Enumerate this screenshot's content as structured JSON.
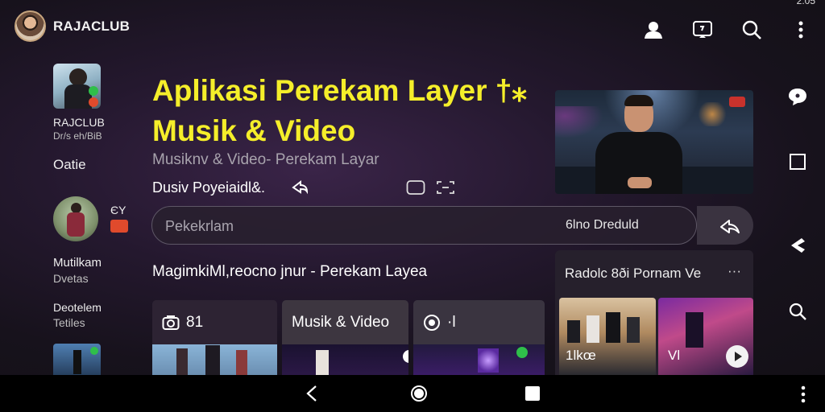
{
  "status": {
    "time": "2:05"
  },
  "header": {
    "brand": "RAJACLUB"
  },
  "sidebar": {
    "items": [
      {
        "label": "RAJCLUB",
        "sub": "Dr/s eh/BiB"
      },
      {
        "label": "Oatie"
      },
      {
        "badge": "ЄY"
      },
      {
        "label": "Mutilkam",
        "sub": "Dvetas"
      },
      {
        "label": "Deotelem",
        "sub": "Tetiles"
      }
    ]
  },
  "main": {
    "title_line1": "Aplikasi Perekam Layer",
    "title_suffix": "†⁎",
    "title_line2": "Musik & Video",
    "subtitle": "Musiknv & Video- Perekam Layar",
    "author": "Dusiv Poyeiaidl&."
  },
  "search": {
    "placeholder": "Pekekrlam",
    "right_text": "6lno Dreduld"
  },
  "section": {
    "title": "MagimkiMl,reocno jnur - Perekam Layea"
  },
  "cards": [
    {
      "label": "81",
      "icon": "camera-icon"
    },
    {
      "label": "Musik & Video"
    },
    {
      "label": "·l",
      "icon": "record-icon"
    }
  ],
  "panel": {
    "title": "Radolc 8ði Pornam Ve",
    "more": "···",
    "thumb1_label": "1lkœ",
    "thumb2_label": "Vl"
  },
  "colors": {
    "title": "#f5ee2a",
    "accent_red": "#e04a2c",
    "accent_green": "#2fbf4a",
    "background": "#1c1522"
  }
}
